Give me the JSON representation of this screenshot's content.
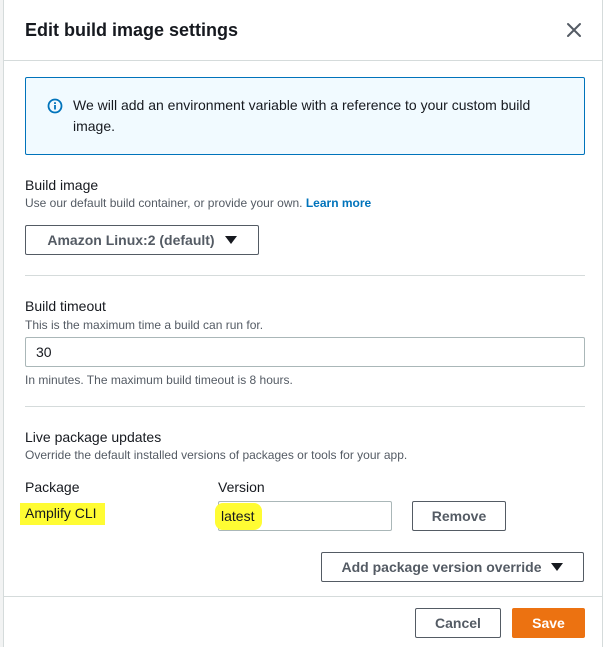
{
  "modal": {
    "title": "Edit build image settings",
    "close_icon": "close-icon"
  },
  "info": {
    "icon": "info-icon",
    "text": "We will add an environment variable with a reference to your custom build image."
  },
  "build_image": {
    "label": "Build image",
    "description": "Use our default build container, or provide your own.",
    "learn_more": "Learn more",
    "selected": "Amazon Linux:2 (default)"
  },
  "build_timeout": {
    "label": "Build timeout",
    "description": "This is the maximum time a build can run for.",
    "value": "30",
    "hint": "In minutes. The maximum build timeout is 8 hours."
  },
  "live_packages": {
    "label": "Live package updates",
    "description": "Override the default installed versions of packages or tools for your app.",
    "package_header": "Package",
    "version_header": "Version",
    "rows": [
      {
        "package": "Amplify CLI",
        "version": "latest",
        "remove_label": "Remove"
      }
    ],
    "add_override_label": "Add package version override"
  },
  "footer": {
    "cancel_label": "Cancel",
    "save_label": "Save"
  },
  "colors": {
    "accent": "#0073bb",
    "primary": "#ec7211",
    "highlight": "#fffc33"
  }
}
